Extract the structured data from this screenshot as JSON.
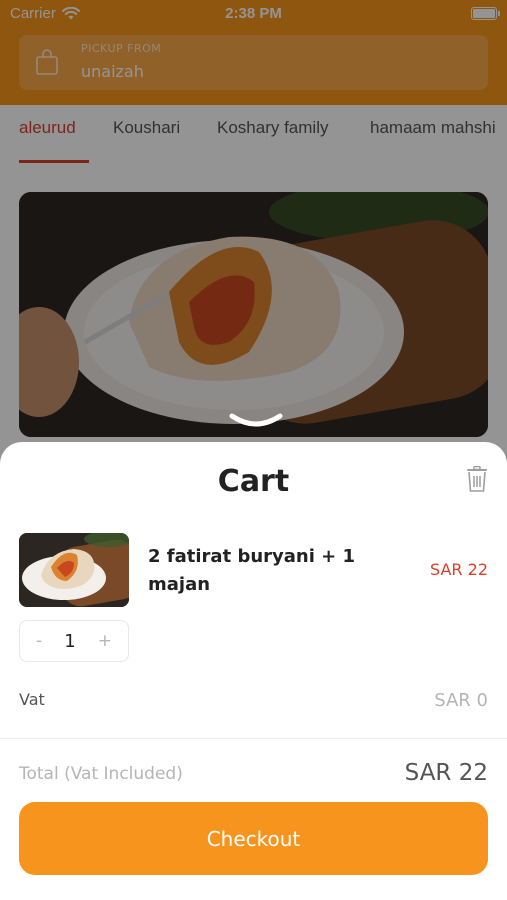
{
  "status_bar": {
    "carrier": "Carrier",
    "time": "2:38 PM"
  },
  "pickup": {
    "label": "PICKUP FROM",
    "value": "unaizah"
  },
  "tabs": [
    {
      "label": "aleurud",
      "active": true
    },
    {
      "label": "Koushari",
      "active": false
    },
    {
      "label": "Koshary family",
      "active": false
    },
    {
      "label": "hamaam mahshi",
      "active": false
    }
  ],
  "cart": {
    "title": "Cart",
    "items": [
      {
        "name": "2 fatirat buryani + 1 majan",
        "price": "SAR 22",
        "quantity": "1",
        "minus": "-",
        "plus": "+"
      }
    ],
    "vat_label": "Vat",
    "vat_value": "SAR 0",
    "total_label": "Total",
    "total_note": "(Vat Included)",
    "total_value": "SAR 22",
    "checkout_label": "Checkout"
  },
  "colors": {
    "accent": "#f7941d",
    "price": "#d9402b",
    "active_tab": "#d9402b"
  },
  "icons": [
    "wifi-icon",
    "battery-icon",
    "shopping-bag-icon",
    "chevron-down-icon",
    "trash-icon"
  ]
}
